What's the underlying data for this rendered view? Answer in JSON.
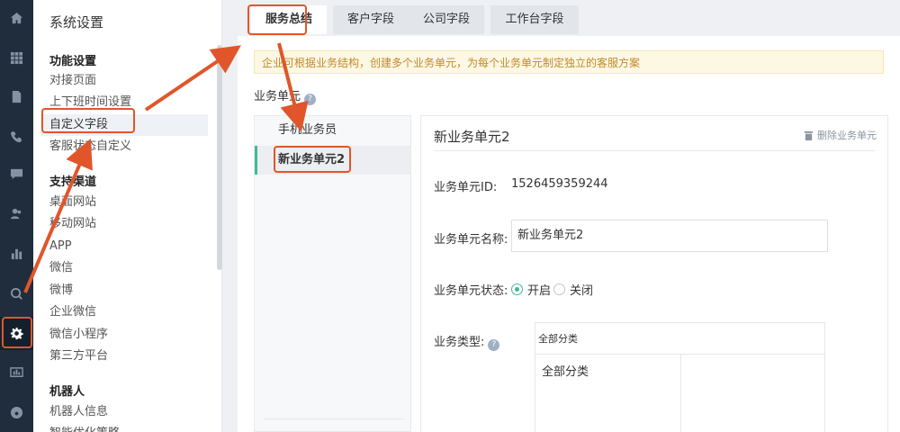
{
  "sidebar": {
    "title": "系统设置",
    "groups": [
      {
        "label": "功能设置",
        "items": [
          "对接页面",
          "上下班时间设置",
          "自定义字段",
          "客服状态自定义"
        ]
      },
      {
        "label": "支持渠道",
        "items": [
          "桌面网站",
          "移动网站",
          "APP",
          "微信",
          "微博",
          "企业微信",
          "微信小程序",
          "第三方平台"
        ]
      },
      {
        "label": "机器人",
        "items": [
          "机器人信息",
          "智能优化策略"
        ]
      }
    ],
    "active_item": "自定义字段"
  },
  "tabs": [
    "服务总结",
    "客户字段",
    "公司字段",
    "工作台字段"
  ],
  "active_tab": "服务总结",
  "notice": "企业可根据业务结构，创建多个业务单元，为每个业务单元制定独立的客服方案",
  "units_label": "业务单元",
  "units": [
    "手机业务员",
    "新业务单元2"
  ],
  "selected_unit": "新业务单元2",
  "detail": {
    "title": "新业务单元2",
    "delete_label": "删除业务单元",
    "id_label": "业务单元ID:",
    "id_value": "1526459359244",
    "name_label": "业务单元名称:",
    "name_value": "新业务单元2",
    "status_label": "业务单元状态:",
    "status_on": "开启",
    "status_off": "关闭",
    "status_value": "开启",
    "type_label": "业务类型:",
    "type_header": "全部分类",
    "type_cell": "全部分类"
  },
  "colors": {
    "annotation": "#e0562a",
    "accent": "#43b89a",
    "rail": "#1f2d3d",
    "notice_text": "#c08a2d"
  },
  "rail_icons": [
    "home-icon",
    "apps-grid-icon",
    "document-icon",
    "phone-icon",
    "chat-icon",
    "users-icon",
    "bar-chart-icon",
    "search-icon",
    "gear-icon",
    "report-icon",
    "gauge-icon"
  ]
}
